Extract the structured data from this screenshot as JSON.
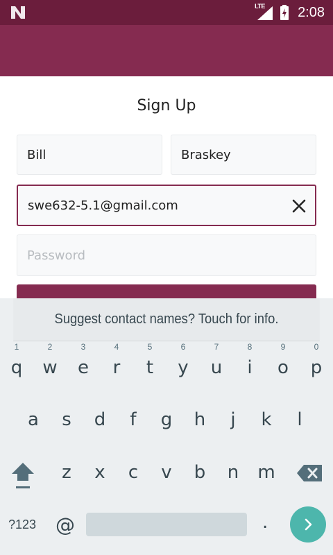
{
  "status_bar": {
    "network": "LTE",
    "time": "2:08"
  },
  "form": {
    "title": "Sign Up",
    "first_name": {
      "value": "Bill"
    },
    "last_name": {
      "value": "Braskey"
    },
    "email": {
      "value": "swe632-5.1@gmail.com"
    },
    "password": {
      "placeholder": "Password"
    }
  },
  "keyboard": {
    "suggestion": "Suggest contact names? Touch for info.",
    "row1": [
      {
        "key": "q",
        "hint": "1"
      },
      {
        "key": "w",
        "hint": "2"
      },
      {
        "key": "e",
        "hint": "3"
      },
      {
        "key": "r",
        "hint": "4"
      },
      {
        "key": "t",
        "hint": "5"
      },
      {
        "key": "y",
        "hint": "6"
      },
      {
        "key": "u",
        "hint": "7"
      },
      {
        "key": "i",
        "hint": "8"
      },
      {
        "key": "o",
        "hint": "9"
      },
      {
        "key": "p",
        "hint": "0"
      }
    ],
    "row2": [
      "a",
      "s",
      "d",
      "f",
      "g",
      "h",
      "j",
      "k",
      "l"
    ],
    "row3": [
      "z",
      "x",
      "c",
      "v",
      "b",
      "n",
      "m"
    ],
    "symbols_label": "?123",
    "at_label": "@",
    "period_label": ".",
    "icons": {
      "shift": "shift-icon",
      "backspace": "backspace-icon",
      "go": "chevron-right-icon"
    }
  },
  "colors": {
    "status_bar": "#6b1d3c",
    "app_bar": "#852b50",
    "accent": "#852b50",
    "go_key": "#4db6ac"
  }
}
